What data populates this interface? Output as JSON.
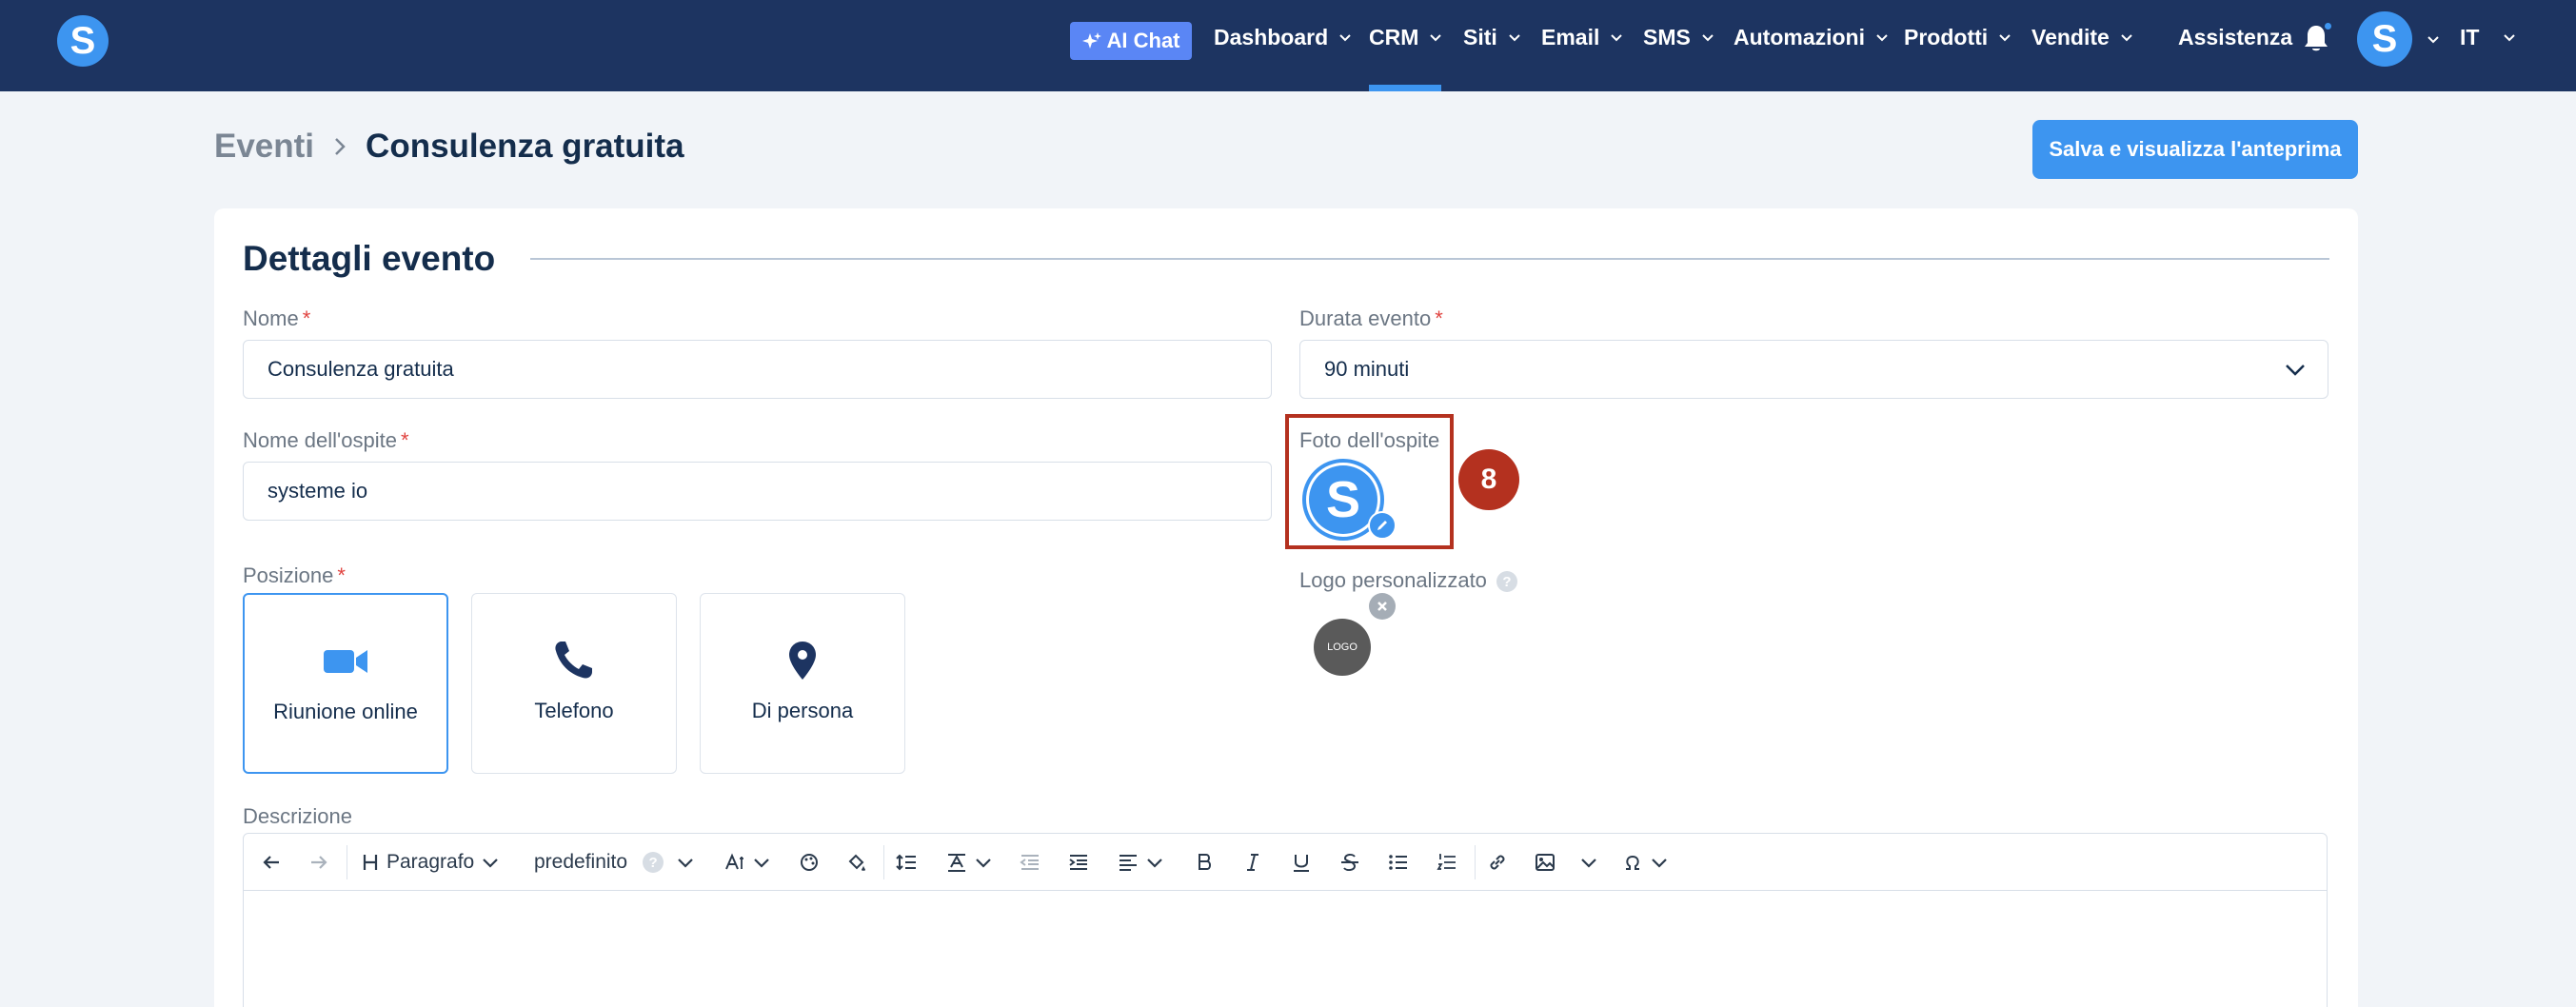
{
  "nav": {
    "ai_chat": "AI Chat",
    "items": [
      "Dashboard",
      "CRM",
      "Siti",
      "Email",
      "SMS",
      "Automazioni",
      "Prodotti",
      "Vendite"
    ],
    "support": "Assistenza",
    "language": "IT",
    "active_item": "CRM",
    "brand_letter": "S",
    "avatar_letter": "S"
  },
  "breadcrumb": {
    "parent": "Eventi",
    "current": "Consulenza gratuita"
  },
  "save_button": "Salva e visualizza l'anteprima",
  "section_title": "Dettagli evento",
  "fields": {
    "name_label": "Nome",
    "name_value": "Consulenza gratuita",
    "duration_label": "Durata evento",
    "duration_value": "90 minuti",
    "host_name_label": "Nome dell'ospite",
    "host_name_value": "systeme io",
    "host_photo_label": "Foto dell'ospite",
    "custom_logo_label": "Logo personalizzato",
    "custom_logo_text": "LOGO",
    "position_label": "Posizione",
    "description_label": "Descrizione",
    "required_mark": "*"
  },
  "positions": [
    {
      "label": "Riunione online",
      "icon": "video-camera-icon",
      "selected": true
    },
    {
      "label": "Telefono",
      "icon": "phone-icon",
      "selected": false
    },
    {
      "label": "Di persona",
      "icon": "map-pin-icon",
      "selected": false
    }
  ],
  "step_badge": "8",
  "editor_toolbar": {
    "heading": "Paragrafo",
    "font": "predefinito",
    "help": "?"
  },
  "colors": {
    "nav_bg": "#1d3461",
    "accent": "#3d95f0",
    "highlight": "#b4311f"
  }
}
